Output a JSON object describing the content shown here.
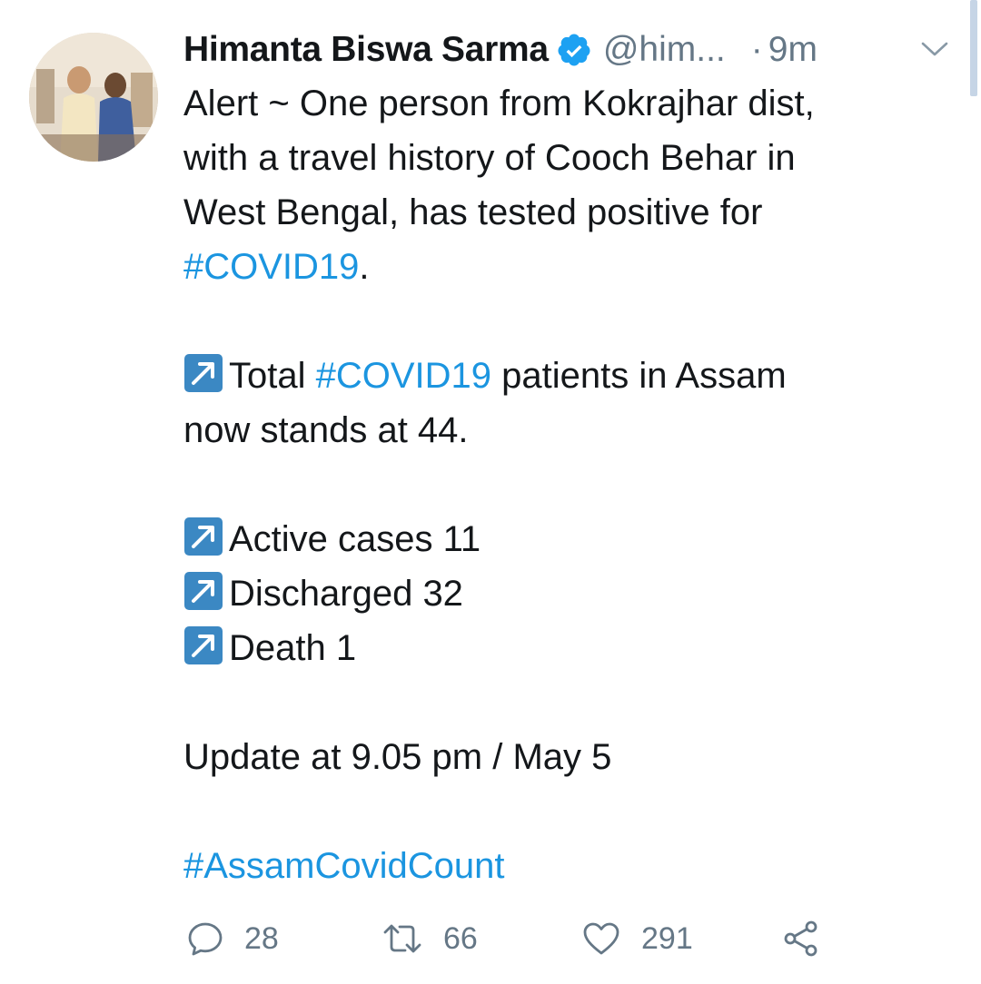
{
  "tweet": {
    "author": {
      "display_name": "Himanta Biswa Sarma",
      "handle": "@him...",
      "verified": true
    },
    "separator": "·",
    "time": "9m",
    "menu_icon": "chevron-down-icon",
    "lines": {
      "l1": "Alert ~ One person from Kokrajhar dist,",
      "l2": "with a travel history of Cooch Behar in",
      "l3": "West Bengal, has tested positive for",
      "l4_tag": "#COVID19",
      "l4_end": ".",
      "l5_pre": "Total ",
      "l5_tag": "#COVID19",
      "l5_post": " patients in Assam",
      "l6": "now stands at 44.",
      "l7": "Active cases 11",
      "l8": "Discharged 32",
      "l9": "Death 1",
      "l10": "Update at 9.05 pm / May 5",
      "l11_tag": "#AssamCovidCount"
    },
    "actions": {
      "reply_count": "28",
      "retweet_count": "66",
      "like_count": "291"
    },
    "colors": {
      "text": "#14171a",
      "secondary": "#657786",
      "link": "#1b95e0",
      "verified": "#1da1f2",
      "arrow_emoji": "#3b88c3"
    }
  }
}
